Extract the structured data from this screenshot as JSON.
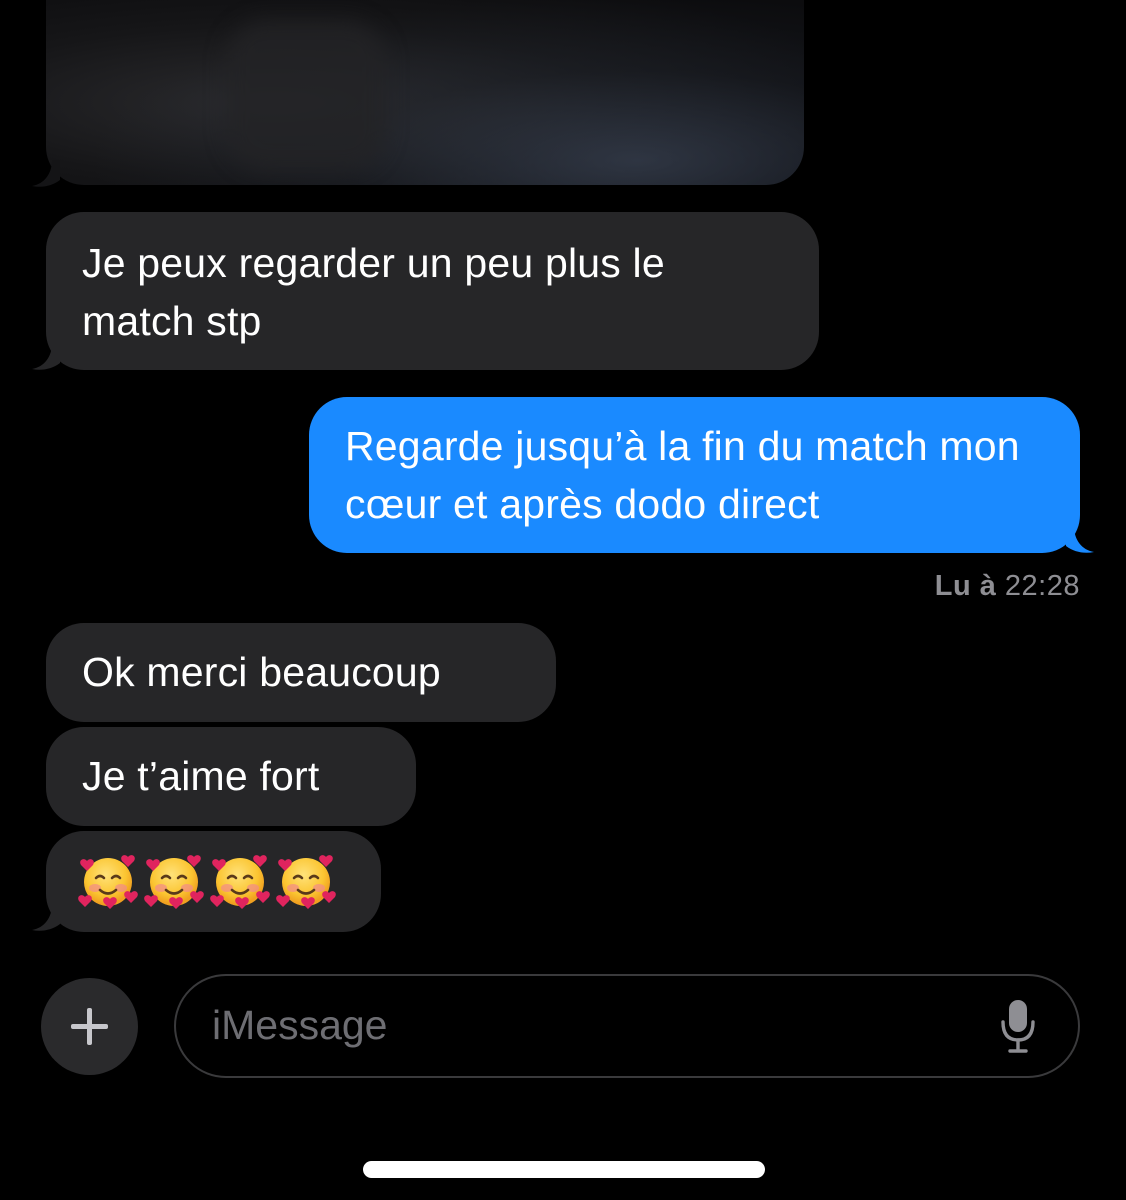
{
  "thread": {
    "messages": [
      {
        "id": "m1",
        "direction": "incoming",
        "text": "Je peux regarder un peu plus le match stp"
      },
      {
        "id": "m2",
        "direction": "outgoing",
        "text": "Regarde jusqu’à la fin du match mon cœur et après dodo direct"
      },
      {
        "id": "m3",
        "direction": "incoming",
        "text": "Ok merci beaucoup"
      },
      {
        "id": "m4",
        "direction": "incoming",
        "text": "Je t’aime fort"
      },
      {
        "id": "m5",
        "direction": "incoming",
        "emoji": [
          "smiling-face-with-hearts",
          "smiling-face-with-hearts",
          "smiling-face-with-hearts",
          "smiling-face-with-hearts"
        ]
      }
    ],
    "read_receipt": {
      "label": "Lu à",
      "time": "22:28"
    }
  },
  "composer": {
    "placeholder": "iMessage",
    "plus_icon": "plus-icon",
    "mic_icon": "microphone-icon"
  },
  "colors": {
    "background": "#000000",
    "incoming_bubble": "#262628",
    "outgoing_bubble": "#1a8aff",
    "receipt_text": "#8e8e93"
  }
}
